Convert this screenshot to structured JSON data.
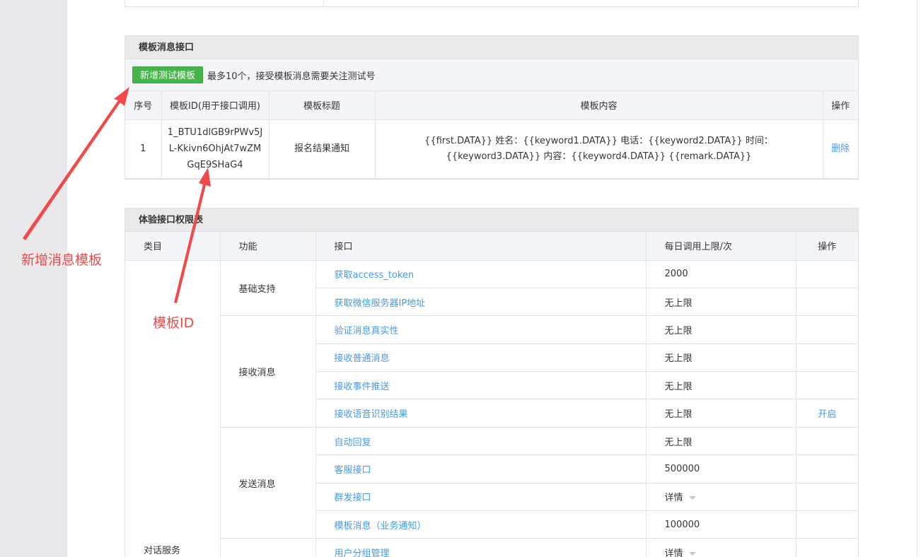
{
  "template_panel": {
    "title": "模板消息接口",
    "add_button": "新增测试模板",
    "note": "最多10个，接受模板消息需要关注测试号",
    "columns": [
      "序号",
      "模板ID(用于接口调用)",
      "模板标题",
      "模板内容",
      "操作"
    ],
    "rows": [
      {
        "index": "1",
        "template_id": "1_BTU1dlGB9rPWv5JL-Kkivn6OhjAt7wZMGqE9SHaG4",
        "title": "报名结果通知",
        "content": "{{first.DATA}} 姓名：{{keyword1.DATA}} 电话：{{keyword2.DATA}} 时间：{{keyword3.DATA}} 内容：{{keyword4.DATA}} {{remark.DATA}}",
        "action": "删除"
      }
    ]
  },
  "permission_panel": {
    "title": "体验接口权限表",
    "columns": [
      "类目",
      "功能",
      "接口",
      "每日调用上限/次",
      "操作"
    ],
    "category": "对话服务",
    "groups": [
      {
        "function": "基础支持",
        "apis": [
          {
            "name": "获取access_token",
            "limit": "2000",
            "action": ""
          },
          {
            "name": "获取微信服务器IP地址",
            "limit": "无上限",
            "action": ""
          }
        ]
      },
      {
        "function": "接收消息",
        "apis": [
          {
            "name": "验证消息真实性",
            "limit": "无上限",
            "action": ""
          },
          {
            "name": "接收普通消息",
            "limit": "无上限",
            "action": ""
          },
          {
            "name": "接收事件推送",
            "limit": "无上限",
            "action": ""
          },
          {
            "name": "接收语音识别结果",
            "limit": "无上限",
            "action": "开启"
          }
        ]
      },
      {
        "function": "发送消息",
        "apis": [
          {
            "name": "自动回复",
            "limit": "无上限",
            "action": ""
          },
          {
            "name": "客服接口",
            "limit": "500000",
            "action": ""
          },
          {
            "name": "群发接口",
            "limit": "详情",
            "action": ""
          },
          {
            "name": "模板消息（业务通知）",
            "limit": "100000",
            "action": ""
          }
        ]
      },
      {
        "function": "",
        "apis": [
          {
            "name": "用户分组管理",
            "limit": "详情",
            "action": ""
          }
        ]
      }
    ]
  },
  "annotations": {
    "add_template": "新增消息模板",
    "template_id": "模板ID"
  },
  "colors": {
    "green_button": "#44b549",
    "link": "#459ae9",
    "annotation": "#f04a4a"
  }
}
